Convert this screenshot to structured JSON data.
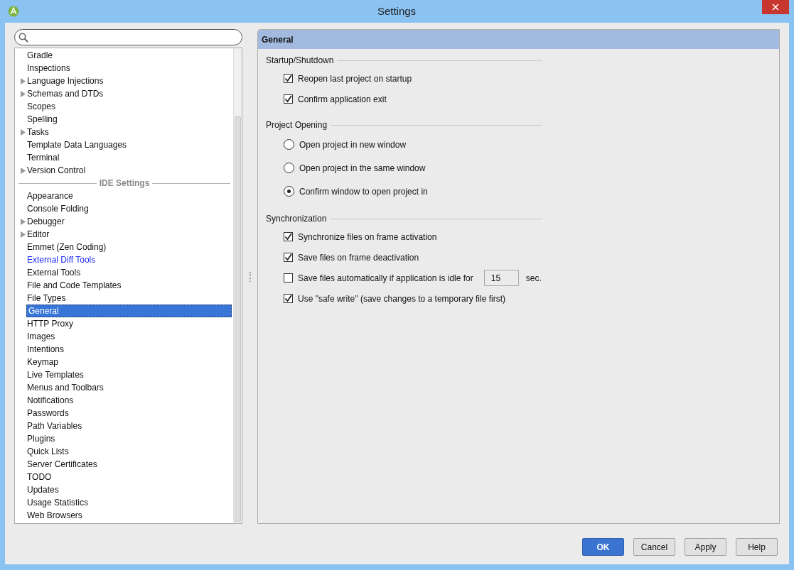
{
  "window": {
    "title": "Settings"
  },
  "tree": [
    {
      "kind": "item",
      "label": "Gradle",
      "expandable": false,
      "selected": false,
      "modified": false
    },
    {
      "kind": "item",
      "label": "Inspections",
      "expandable": false,
      "selected": false,
      "modified": false
    },
    {
      "kind": "item",
      "label": "Language Injections",
      "expandable": true,
      "selected": false,
      "modified": false
    },
    {
      "kind": "item",
      "label": "Schemas and DTDs",
      "expandable": true,
      "selected": false,
      "modified": false
    },
    {
      "kind": "item",
      "label": "Scopes",
      "expandable": false,
      "selected": false,
      "modified": false
    },
    {
      "kind": "item",
      "label": "Spelling",
      "expandable": false,
      "selected": false,
      "modified": false
    },
    {
      "kind": "item",
      "label": "Tasks",
      "expandable": true,
      "selected": false,
      "modified": false
    },
    {
      "kind": "item",
      "label": "Template Data Languages",
      "expandable": false,
      "selected": false,
      "modified": false
    },
    {
      "kind": "item",
      "label": "Terminal",
      "expandable": false,
      "selected": false,
      "modified": false
    },
    {
      "kind": "item",
      "label": "Version Control",
      "expandable": true,
      "selected": false,
      "modified": false
    },
    {
      "kind": "separator",
      "label": "IDE Settings"
    },
    {
      "kind": "item",
      "label": "Appearance",
      "expandable": false,
      "selected": false,
      "modified": false
    },
    {
      "kind": "item",
      "label": "Console Folding",
      "expandable": false,
      "selected": false,
      "modified": false
    },
    {
      "kind": "item",
      "label": "Debugger",
      "expandable": true,
      "selected": false,
      "modified": false
    },
    {
      "kind": "item",
      "label": "Editor",
      "expandable": true,
      "selected": false,
      "modified": false
    },
    {
      "kind": "item",
      "label": "Emmet (Zen Coding)",
      "expandable": false,
      "selected": false,
      "modified": false
    },
    {
      "kind": "item",
      "label": "External Diff Tools",
      "expandable": false,
      "selected": false,
      "modified": true
    },
    {
      "kind": "item",
      "label": "External Tools",
      "expandable": false,
      "selected": false,
      "modified": false
    },
    {
      "kind": "item",
      "label": "File and Code Templates",
      "expandable": false,
      "selected": false,
      "modified": false
    },
    {
      "kind": "item",
      "label": "File Types",
      "expandable": false,
      "selected": false,
      "modified": false
    },
    {
      "kind": "item",
      "label": "General",
      "expandable": false,
      "selected": true,
      "modified": false
    },
    {
      "kind": "item",
      "label": "HTTP Proxy",
      "expandable": false,
      "selected": false,
      "modified": false
    },
    {
      "kind": "item",
      "label": "Images",
      "expandable": false,
      "selected": false,
      "modified": false
    },
    {
      "kind": "item",
      "label": "Intentions",
      "expandable": false,
      "selected": false,
      "modified": false
    },
    {
      "kind": "item",
      "label": "Keymap",
      "expandable": false,
      "selected": false,
      "modified": false
    },
    {
      "kind": "item",
      "label": "Live Templates",
      "expandable": false,
      "selected": false,
      "modified": false
    },
    {
      "kind": "item",
      "label": "Menus and Toolbars",
      "expandable": false,
      "selected": false,
      "modified": false
    },
    {
      "kind": "item",
      "label": "Notifications",
      "expandable": false,
      "selected": false,
      "modified": false
    },
    {
      "kind": "item",
      "label": "Passwords",
      "expandable": false,
      "selected": false,
      "modified": false
    },
    {
      "kind": "item",
      "label": "Path Variables",
      "expandable": false,
      "selected": false,
      "modified": false
    },
    {
      "kind": "item",
      "label": "Plugins",
      "expandable": false,
      "selected": false,
      "modified": false
    },
    {
      "kind": "item",
      "label": "Quick Lists",
      "expandable": false,
      "selected": false,
      "modified": false
    },
    {
      "kind": "item",
      "label": "Server Certificates",
      "expandable": false,
      "selected": false,
      "modified": false
    },
    {
      "kind": "item",
      "label": "TODO",
      "expandable": false,
      "selected": false,
      "modified": false
    },
    {
      "kind": "item",
      "label": "Updates",
      "expandable": false,
      "selected": false,
      "modified": false
    },
    {
      "kind": "item",
      "label": "Usage Statistics",
      "expandable": false,
      "selected": false,
      "modified": false
    },
    {
      "kind": "item",
      "label": "Web Browsers",
      "expandable": false,
      "selected": false,
      "modified": false
    }
  ],
  "panel": {
    "title": "General",
    "sections": [
      {
        "title": "Startup/Shutdown",
        "options": [
          {
            "kind": "checkbox",
            "label": "Reopen last project on startup",
            "checked": true
          },
          {
            "kind": "checkbox",
            "label": "Confirm application exit",
            "checked": true
          }
        ]
      },
      {
        "title": "Project Opening",
        "options": [
          {
            "kind": "radio",
            "label": "Open project in new window",
            "selected": false
          },
          {
            "kind": "radio",
            "label": "Open project in the same window",
            "selected": false
          },
          {
            "kind": "radio",
            "label": "Confirm window to open project in",
            "selected": true
          }
        ]
      },
      {
        "title": "Synchronization",
        "options": [
          {
            "kind": "checkbox",
            "label": "Synchronize files on frame activation",
            "checked": true
          },
          {
            "kind": "checkbox",
            "label": "Save files on frame deactivation",
            "checked": true
          },
          {
            "kind": "checkbox_field",
            "label": "Save files automatically if application is idle for",
            "checked": false,
            "value": "15",
            "suffix": "sec."
          },
          {
            "kind": "checkbox",
            "label": "Use \"safe write\" (save changes to a temporary file first)",
            "checked": true
          }
        ]
      }
    ]
  },
  "buttons": [
    {
      "label": "OK",
      "default": true
    },
    {
      "label": "Cancel",
      "default": false
    },
    {
      "label": "Apply",
      "default": false
    },
    {
      "label": "Help",
      "default": false
    }
  ]
}
